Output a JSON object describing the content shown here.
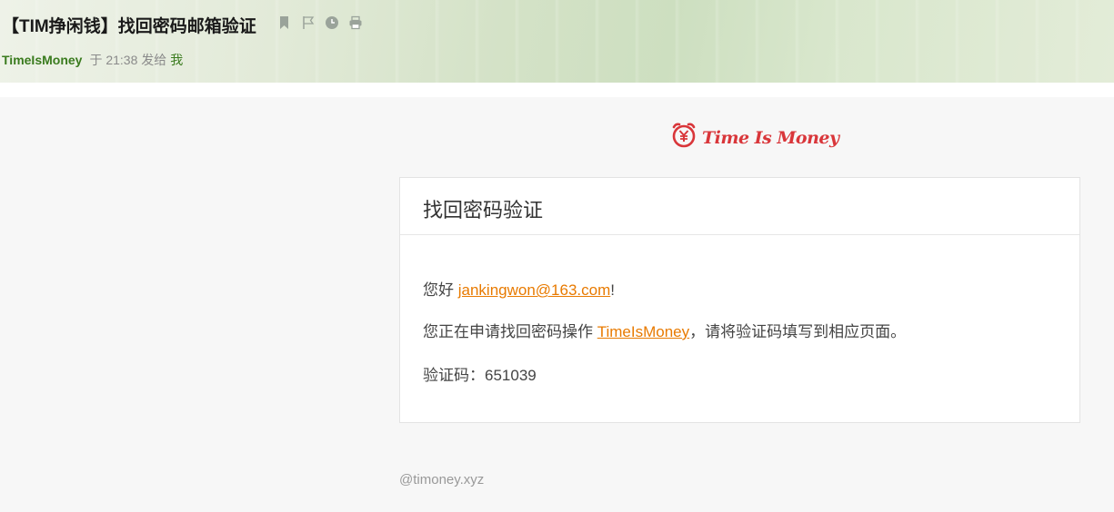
{
  "email": {
    "subject": "【TIM挣闲钱】找回密码邮箱验证",
    "sender": "TimeIsMoney",
    "time_prefix": "于",
    "time": "21:38",
    "sent_to_label": "发给",
    "recipient": "我",
    "header_icons": [
      "bookmark-icon",
      "flag-icon",
      "clock-icon",
      "print-icon"
    ]
  },
  "body": {
    "logo_text": "Time Is Money",
    "card_title": "找回密码验证",
    "greeting_prefix": "您好 ",
    "greeting_email": "jankingwon@163.com",
    "greeting_suffix": "!",
    "line2_prefix": "您正在申请找回密码操作 ",
    "line2_link": "TimeIsMoney",
    "line2_suffix": "，请将验证码填写到相应页面。",
    "code_label": "验证码：",
    "code_value": "651039",
    "footer": "@timoney.xyz"
  },
  "colors": {
    "accent_link": "#e87a00",
    "sender_green": "#3a7b1e",
    "logo_red": "#d9363a"
  }
}
